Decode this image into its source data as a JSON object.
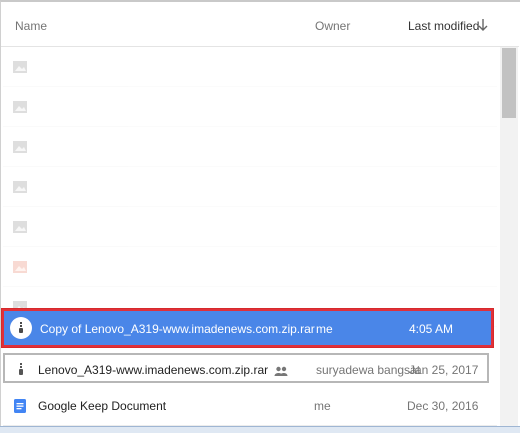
{
  "header": {
    "name": "Name",
    "owner": "Owner",
    "last_modified": "Last modified",
    "sort_icon": "arrow-down-icon"
  },
  "files": [
    {
      "name": "",
      "owner": "",
      "modified": "",
      "icon": "image-icon",
      "state": "faded"
    },
    {
      "name": "",
      "owner": "",
      "modified": "",
      "icon": "image-icon",
      "state": "faded"
    },
    {
      "name": "",
      "owner": "",
      "modified": "",
      "icon": "image-icon",
      "state": "faded"
    },
    {
      "name": "",
      "owner": "",
      "modified": "",
      "icon": "image-icon",
      "state": "faded"
    },
    {
      "name": "",
      "owner": "",
      "modified": "",
      "icon": "image-icon",
      "state": "faded"
    },
    {
      "name": "",
      "owner": "",
      "modified": "",
      "icon": "image-icon",
      "state": "faded"
    },
    {
      "name": "",
      "owner": "",
      "modified": "",
      "icon": "image-icon",
      "state": "faded"
    },
    {
      "name": "Copy of Lenovo_A319-www.imadenews.com.zip.rar",
      "owner": "me",
      "modified": "4:05 AM",
      "icon": "zip-icon",
      "state": "selected"
    },
    {
      "name": "Lenovo_A319-www.imadenews.com.zip.rar",
      "owner": "suryadewa bangsat",
      "modified": "Jan 25, 2017",
      "icon": "zip-icon",
      "shared_icon": "people-icon",
      "state": "outlined"
    },
    {
      "name": "Google Keep Document",
      "owner": "me",
      "modified": "Dec 30, 2016",
      "icon": "google-docs-icon",
      "state": "normal"
    }
  ],
  "colors": {
    "selection": "#4a86e8",
    "selection_border": "#d62a2a",
    "docs_blue": "#4285f4"
  }
}
